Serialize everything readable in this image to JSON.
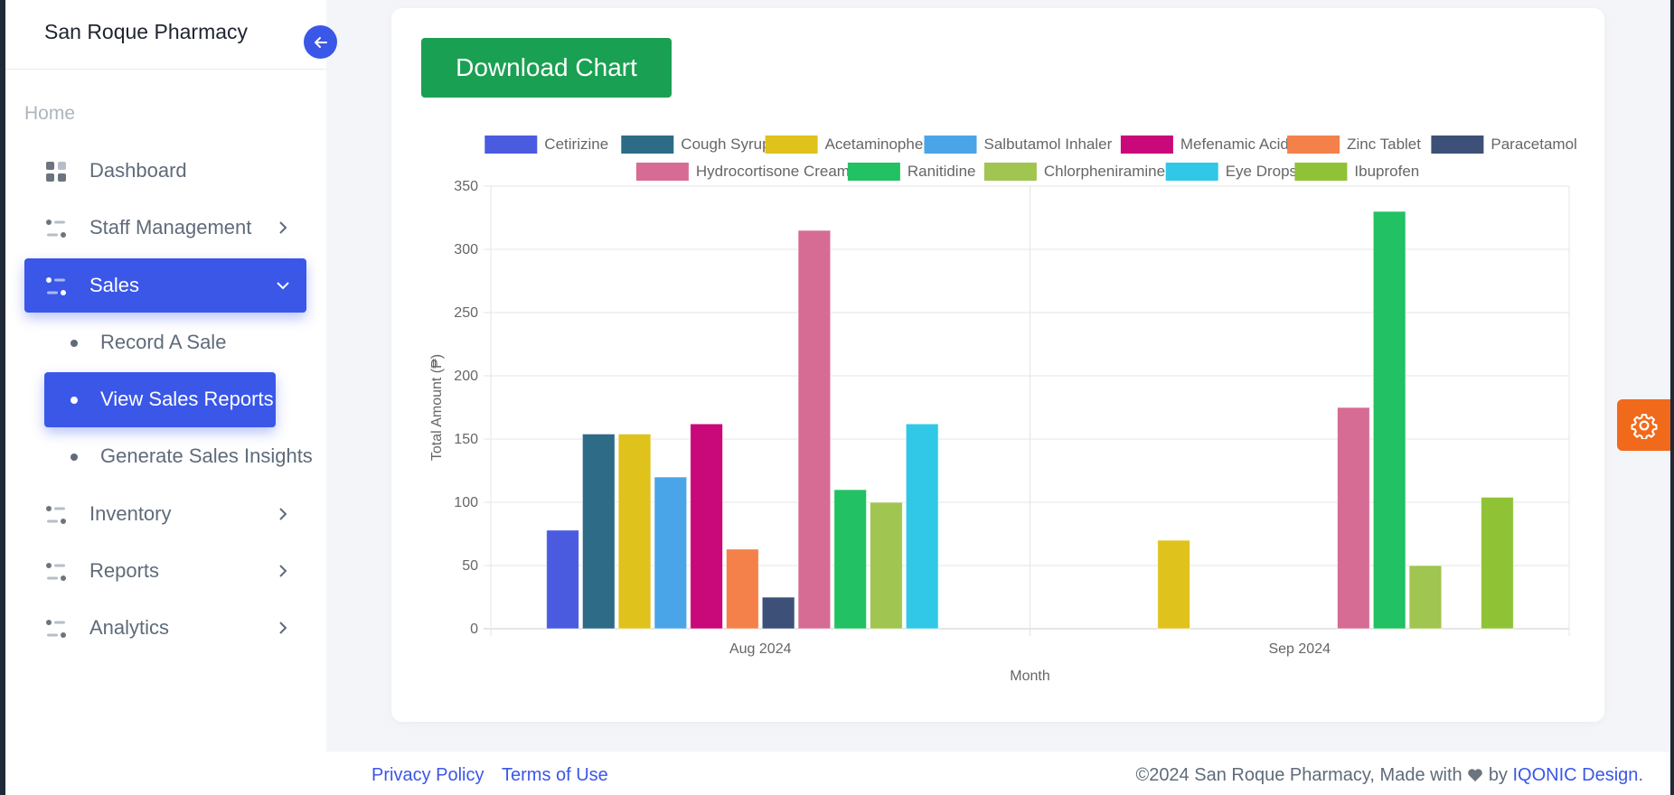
{
  "sidebar": {
    "brand": "San Roque Pharmacy",
    "section_label": "Home",
    "items": {
      "dashboard": "Dashboard",
      "staff": "Staff Management",
      "sales": "Sales",
      "record_sale": "Record A Sale",
      "view_reports": "View Sales Reports",
      "insights": "Generate Sales Insights",
      "inventory": "Inventory",
      "reports": "Reports",
      "analytics": "Analytics"
    }
  },
  "toolbar": {
    "download_label": "Download Chart"
  },
  "footer": {
    "privacy": "Privacy Policy",
    "terms": "Terms of Use",
    "copyright_prefix": "©2024 San Roque Pharmacy, Made with",
    "copyright_by": "by",
    "credit": "IQONIC Design",
    "copyright_suffix": "."
  },
  "colors": {
    "primary": "#3a57e8",
    "success": "#1aa053",
    "settings": "#f16a1b"
  },
  "icons": {
    "collapse": "arrow-left-icon",
    "dashboard": "grid-icon",
    "menu": "list-icon",
    "chevron_right": "chevron-right-icon",
    "chevron_down": "chevron-down-icon",
    "settings": "gear-icon",
    "heart": "heart-icon"
  },
  "chart_data": {
    "type": "bar",
    "categories": [
      "Aug 2024",
      "Sep 2024"
    ],
    "xlabel": "Month",
    "ylabel": "Total Amount (₱)",
    "ylim": [
      0,
      350
    ],
    "yticks": [
      0,
      50,
      100,
      150,
      200,
      250,
      300,
      350
    ],
    "grid": true,
    "legend": "top",
    "series": [
      {
        "name": "Cetirizine",
        "color": "#4a5be0",
        "values": [
          78,
          null
        ]
      },
      {
        "name": "Cough Syrup",
        "color": "#2e6b86",
        "values": [
          154,
          null
        ]
      },
      {
        "name": "Acetaminophen",
        "color": "#e0c21d",
        "values": [
          154,
          70
        ]
      },
      {
        "name": "Salbutamol Inhaler",
        "color": "#4aa5e8",
        "values": [
          120,
          null
        ]
      },
      {
        "name": "Mefenamic Acid",
        "color": "#c9087a",
        "values": [
          162,
          null
        ]
      },
      {
        "name": "Zinc Tablet",
        "color": "#f4814a",
        "values": [
          63,
          null
        ]
      },
      {
        "name": "Paracetamol",
        "color": "#3d5078",
        "values": [
          25,
          null
        ]
      },
      {
        "name": "Hydrocortisone Cream",
        "color": "#d66c93",
        "values": [
          315,
          175
        ]
      },
      {
        "name": "Ranitidine",
        "color": "#22c163",
        "values": [
          110,
          330
        ]
      },
      {
        "name": "Chlorpheniramine",
        "color": "#a0c550",
        "values": [
          100,
          50
        ]
      },
      {
        "name": "Eye Drops",
        "color": "#30c8e6",
        "values": [
          162,
          null
        ]
      },
      {
        "name": "Ibuprofen",
        "color": "#90c236",
        "values": [
          null,
          104
        ]
      }
    ]
  }
}
